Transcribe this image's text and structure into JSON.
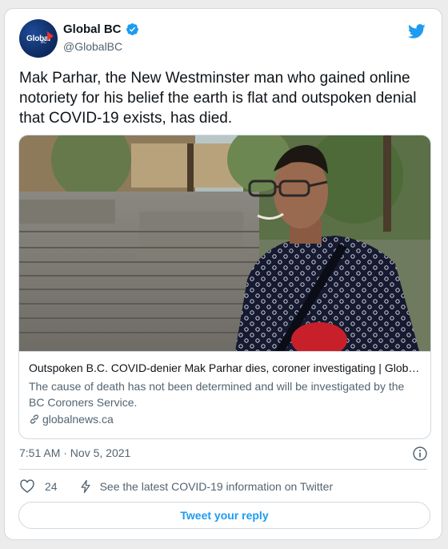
{
  "account": {
    "display_name": "Global BC",
    "handle": "@GlobalBC",
    "avatar_text": "Global",
    "avatar_subtext": "BC",
    "verified": true
  },
  "tweet": {
    "text": "Mak Parhar, the New Westminster man who gained online notoriety for his belief the earth is flat and outspoken denial that COVID-19 exists, has died.",
    "timestamp": "7:51 AM · Nov 5, 2021"
  },
  "link_card": {
    "title": "Outspoken B.C. COVID-denier Mak Parhar dies, coroner investigating | Globalnews.ca",
    "description": "The cause of death has not been determined and will be investigated by the BC Coroners Service.",
    "domain": "globalnews.ca"
  },
  "actions": {
    "like_count": "24",
    "covid_info_label": "See the latest COVID-19 information on Twitter",
    "reply_label": "Tweet your reply"
  },
  "icons": {
    "brand": "twitter-bird-icon",
    "verified": "verified-badge-icon",
    "info": "info-icon",
    "like": "heart-icon",
    "covid": "lightning-bolt-icon",
    "link": "link-chain-icon"
  },
  "colors": {
    "twitter_blue": "#1d9bf0",
    "text_primary": "#0f1419",
    "text_secondary": "#536471",
    "border": "#cfd9de",
    "avatar_bg": "#0f2e66",
    "avatar_accent": "#e8322b"
  }
}
